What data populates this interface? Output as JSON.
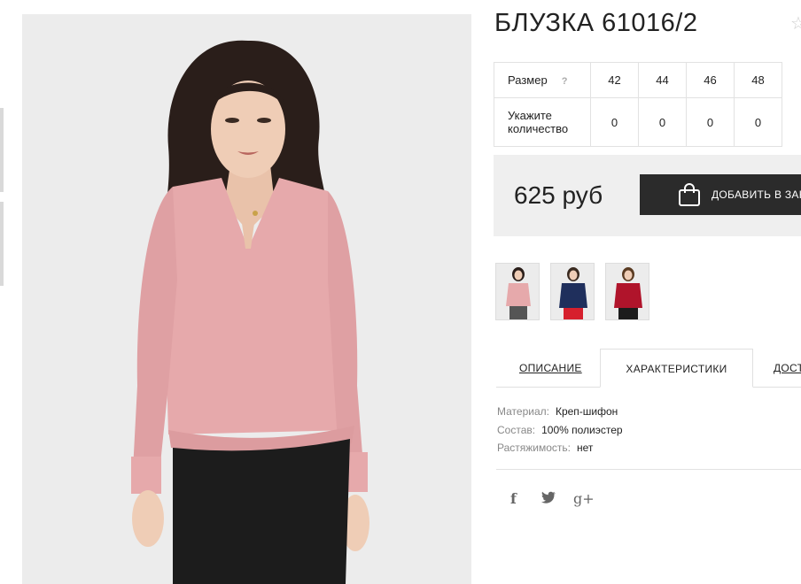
{
  "product": {
    "title": "БЛУЗКА 61016/2"
  },
  "sizes": {
    "size_label": "Размер",
    "help": "?",
    "qty_label_1": "Укажите",
    "qty_label_2": "количество",
    "values": [
      "42",
      "44",
      "46",
      "48"
    ],
    "quantities": [
      "0",
      "0",
      "0",
      "0"
    ]
  },
  "price": {
    "amount": "625 руб",
    "cart_label": "ДОБАВИТЬ В ЗАКАЗ"
  },
  "thumbnails": [
    {
      "color": "pink-blouse"
    },
    {
      "color": "navy-blouse"
    },
    {
      "color": "red-blouse"
    }
  ],
  "tabs": [
    {
      "label": "ОПИСАНИЕ"
    },
    {
      "label": "ХАРАКТЕРИСТИКИ"
    },
    {
      "label": "ДОСТАВКА"
    }
  ],
  "characteristics": [
    {
      "key": "Материал:",
      "value": "Креп-шифон"
    },
    {
      "key": "Состав:",
      "value": "100% полиэстер"
    },
    {
      "key": "Растяжимость:",
      "value": "нет"
    }
  ],
  "social": [
    "f",
    "t",
    "g+"
  ],
  "colors": {
    "blouse": "#e6a9ab",
    "skirt": "#1c1c1c",
    "hair": "#2a1e1a",
    "button": "#2b2b2b",
    "price_bg": "#efefef"
  }
}
